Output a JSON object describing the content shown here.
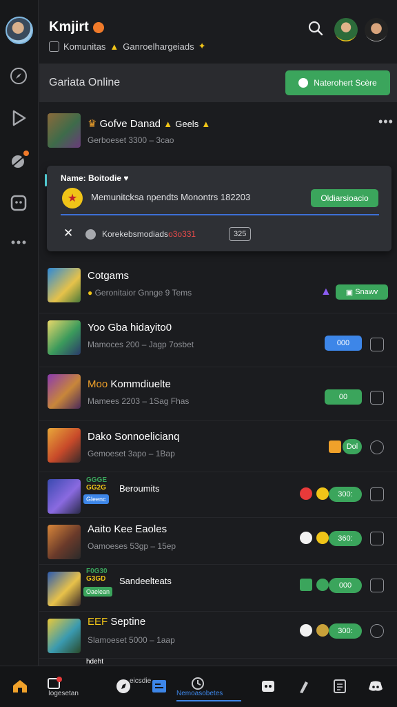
{
  "header": {
    "title": "Kmjirt",
    "subtitle": "Komunitas",
    "subtitle_extra": "Ganroelhargeiads"
  },
  "online_bar": {
    "label": "Gariata Online",
    "button_label": "Naterohert Scère"
  },
  "top_chat": {
    "name": "Gofve Danad",
    "name_extra": "Geels",
    "sub": "Gerboeset 3300 – 3cao"
  },
  "popup": {
    "title": "Name: Boitodie",
    "text": "Memunitcksa npendts Monontrs 182203",
    "button": "Oldiarsioacio",
    "message": "Korekebsmodiads",
    "message_red": "o3o331",
    "count": "325"
  },
  "rows": [
    {
      "name": "Cotgams",
      "sub": "Geronitaior Gnnge 9 Tems",
      "pill": "Snawv",
      "pill_color": "#3ba55c"
    },
    {
      "name": "Yoo Gba hidayito0",
      "sub": "Mamoces 200 – Jagp 7osbet",
      "pill": "000",
      "pill_color": "#3d86e8"
    },
    {
      "name": "Kommdiuelte",
      "name_prefix": "Moo",
      "sub": "Mamees 2203 – 1Sag Fhas",
      "pill": "00",
      "pill_color": "#3ba55c"
    },
    {
      "name": "Dako Sonnoelicianq",
      "sub": "Gemoeset 3apo – 1Bap",
      "pill": "Dol",
      "pill_color": "#3ba55c"
    },
    {
      "name": "Beroumits",
      "tag_lines": [
        "GGGE",
        "GG2G"
      ],
      "chip": "Gleenc",
      "pill": "300:",
      "pill_color": "#3ba55c"
    },
    {
      "name": "Aaito Kee Eaoles",
      "sub": "Oamoeses 53gp – 15ep",
      "pill": "360:",
      "pill_color": "#3ba55c"
    },
    {
      "name": "Sandeelteats",
      "tag_lines": [
        "F0G30",
        "G3GD"
      ],
      "chip": "Oaelean",
      "pill": "000",
      "pill_color": "#3ba55c"
    },
    {
      "name": "Septine",
      "name_prefix": "EEF",
      "sub": "Slamoeset 5000 – 1aap",
      "pill": "300:",
      "pill_color": "#3ba55c"
    }
  ],
  "partial_row": {
    "name": "hdeht"
  },
  "bottom_nav": {
    "label_1": "Iogesetan",
    "label_2": "eicsdie",
    "label_3": "Nemoasobetes"
  },
  "colors": {
    "accent_green": "#3ba55c",
    "accent_blue": "#3d86e8",
    "badge_orange": "#f07a2a",
    "background": "#1b1c1f"
  }
}
